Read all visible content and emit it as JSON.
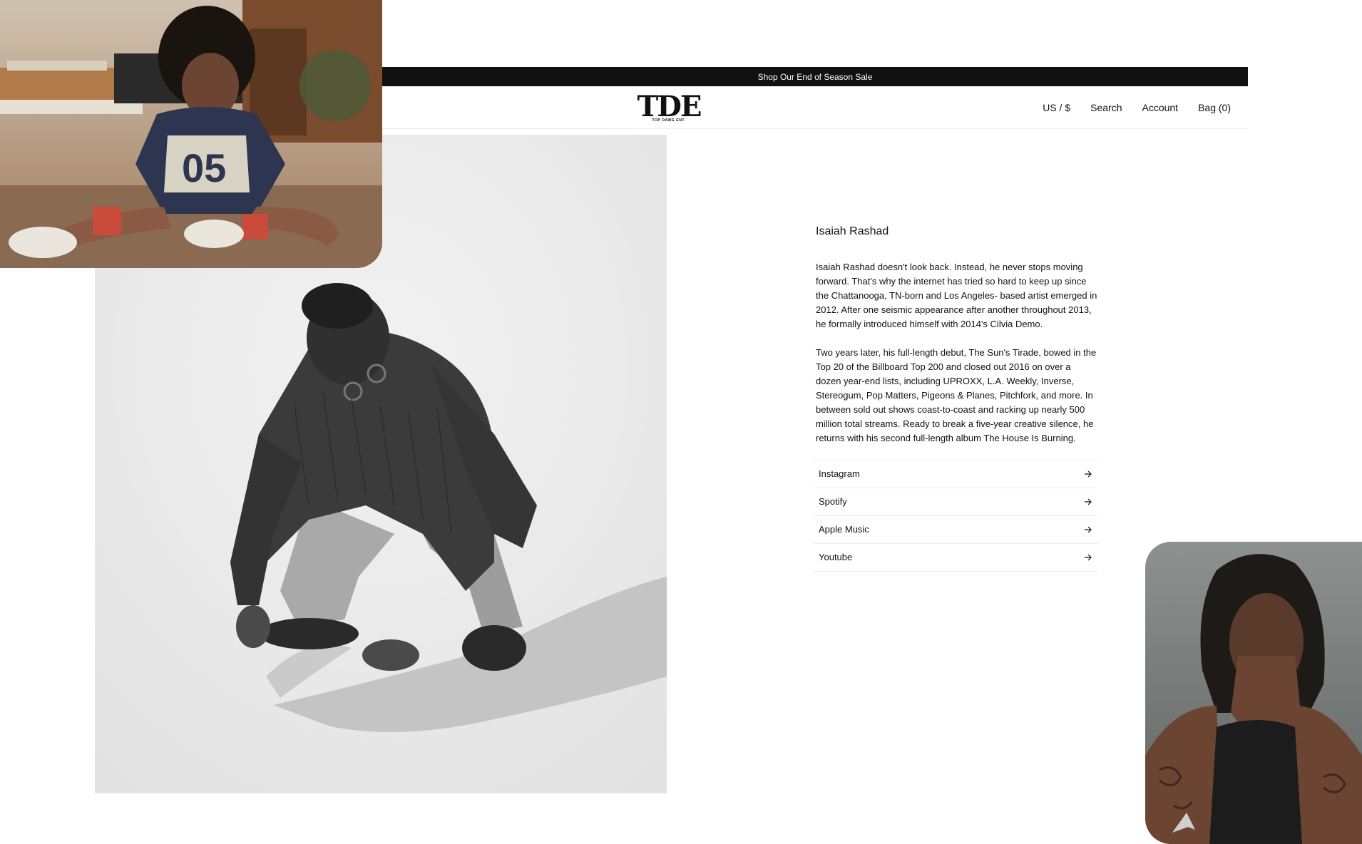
{
  "promo": {
    "text": "Shop Our End of Season Sale"
  },
  "header": {
    "logo_text": "TDE",
    "logo_sub": "TOP DAWG ENT.",
    "nav": {
      "currency": "US / $",
      "search": "Search",
      "account": "Account",
      "bag": "Bag (0)"
    }
  },
  "artist": {
    "name": "Isaiah Rashad",
    "bio": [
      "Isaiah Rashad doesn't look back. Instead, he never stops moving forward. That's why the internet has tried so hard to keep up since the Chattanooga, TN-born and Los Angeles- based artist emerged in 2012. After one seismic appearance after another throughout 2013, he formally introduced himself with 2014's Cilvia Demo.",
      "Two years later, his full-length debut, The Sun's Tirade, bowed in the Top 20 of the Billboard Top 200 and closed out 2016 on over a dozen year-end lists, including UPROXX, L.A. Weekly, Inverse, Stereogum, Pop Matters, Pigeons & Planes, Pitchfork, and more. In between sold out shows coast-to-coast and racking up nearly 500 million total streams. Ready to break a five-year creative silence, he returns with his second full-length album The House Is Burning."
    ],
    "links": [
      {
        "label": "Instagram"
      },
      {
        "label": "Spotify"
      },
      {
        "label": "Apple Music"
      },
      {
        "label": "Youtube"
      }
    ]
  },
  "colors": {
    "promo_bg": "#111111",
    "text": "#111111",
    "divider": "#ececec",
    "hero_bg": "#ececec"
  }
}
